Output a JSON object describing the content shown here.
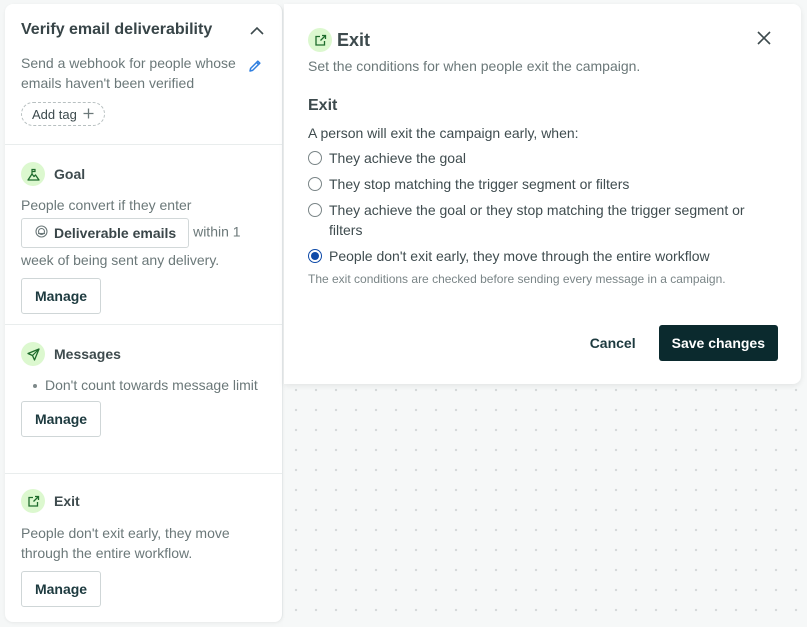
{
  "workflow": {
    "title": "Verify email deliverability",
    "description": "Send a webhook for people whose emails haven't been verified",
    "add_tag_label": "Add tag"
  },
  "sections": {
    "goal": {
      "title": "Goal",
      "text_before": "People convert if they enter",
      "segment": "Deliverable emails",
      "text_after": "within 1 week of being sent any delivery.",
      "manage_label": "Manage"
    },
    "messages": {
      "title": "Messages",
      "bullets": [
        "Don't count towards message limit"
      ],
      "manage_label": "Manage"
    },
    "exit": {
      "title": "Exit",
      "text": "People don't exit early, they move through the entire workflow.",
      "manage_label": "Manage"
    }
  },
  "modal": {
    "title": "Exit",
    "subtitle": "Set the conditions for when people exit the campaign.",
    "section_label": "Exit",
    "prompt": "A person will exit the campaign early, when:",
    "options": [
      {
        "label": "They achieve the goal",
        "checked": false
      },
      {
        "label": "They stop matching the trigger segment or filters",
        "checked": false
      },
      {
        "label": "They achieve the goal or they stop matching the trigger segment or filters",
        "checked": false
      },
      {
        "label": "People don't exit early, they move through the entire workflow",
        "checked": true
      }
    ],
    "hint": "The exit conditions are checked before sending every message in a campaign.",
    "cancel_label": "Cancel",
    "save_label": "Save changes"
  },
  "colors": {
    "accent_blue": "#0e4aa8",
    "primary_button": "#0b2a2e",
    "icon_bg": "#dcf8cf",
    "icon_fg": "#1e6b2c",
    "edit_icon": "#2f7fe0"
  }
}
